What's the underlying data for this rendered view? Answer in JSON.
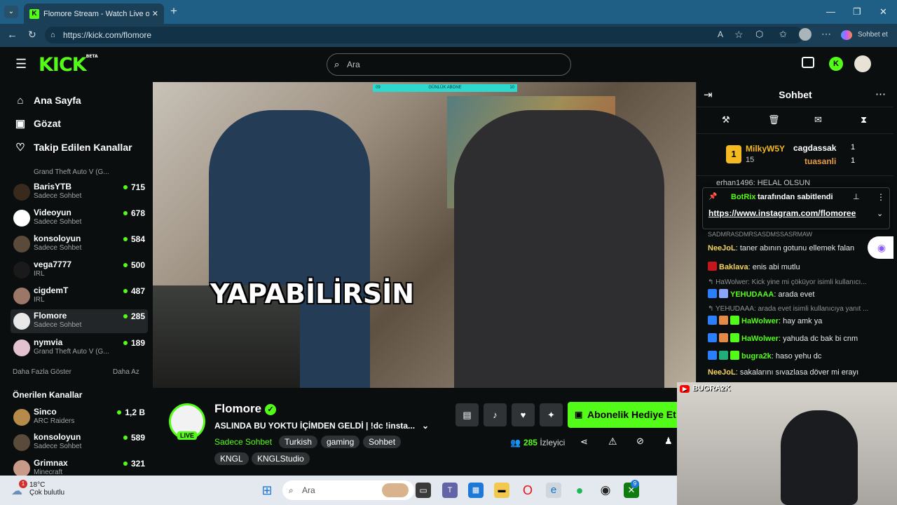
{
  "browser": {
    "tab_title": "Flomore Stream - Watch Live on Kick",
    "url": "https://kick.com/flomore",
    "copilot_label": "Sohbet et",
    "window_controls": [
      "—",
      "❐",
      "✕"
    ]
  },
  "header": {
    "logo_text": "KICK",
    "logo_beta": "BETA",
    "search_placeholder": "Ara"
  },
  "sidebar": {
    "nav": [
      {
        "label": "Ana Sayfa",
        "icon": "home-icon"
      },
      {
        "label": "Gözat",
        "icon": "browse-icon"
      },
      {
        "label": "Takip Edilen Kanallar",
        "icon": "heart-icon"
      }
    ],
    "partial_top_category": "Grand Theft Auto V (G...",
    "followed": [
      {
        "name": "BarisYTB",
        "category": "Sadece Sohbet",
        "viewers": "715"
      },
      {
        "name": "Videoyun",
        "category": "Sadece Sohbet",
        "viewers": "678"
      },
      {
        "name": "konsoloyun",
        "category": "Sadece Sohbet",
        "viewers": "584"
      },
      {
        "name": "vega7777",
        "category": "IRL",
        "viewers": "500"
      },
      {
        "name": "cigdemT",
        "category": "IRL",
        "viewers": "487"
      },
      {
        "name": "Flomore",
        "category": "Sadece Sohbet",
        "viewers": "285"
      },
      {
        "name": "nymvia",
        "category": "Grand Theft Auto V (G...",
        "viewers": "189"
      }
    ],
    "show_more": "Daha Fazla Göster",
    "show_less": "Daha Az",
    "recommended_title": "Önerilen Kanallar",
    "recommended": [
      {
        "name": "Sinco",
        "category": "ARC Raiders",
        "viewers": "1,2 B"
      },
      {
        "name": "konsoloyun",
        "category": "Sadece Sohbet",
        "viewers": "589"
      },
      {
        "name": "Grimnax",
        "category": "Minecraft",
        "viewers": "321"
      }
    ]
  },
  "video": {
    "caption": "YAPABİLİRSİN",
    "sub_goal_label": "GÜNLÜK ABONE",
    "sub_goal_left": "09",
    "sub_goal_right": "10"
  },
  "stream_info": {
    "channel": "Flomore",
    "live_badge": "LIVE",
    "title": "ASLINDA BU YOKTU İÇİMDEN GELDİ | !dc !insta...",
    "category": "Sadece Sohbet",
    "tags": [
      "Turkish",
      "gaming",
      "Sohbet",
      "KNGL",
      "KNGLStudio"
    ],
    "gift_button": "Abonelik Hediye Et",
    "viewer_count": "285",
    "viewer_label": "İzleyici"
  },
  "chat": {
    "title": "Sohbet",
    "leaderboard": {
      "first_name": "MilkyW5Y",
      "first_count": "15",
      "second_name": "cagdassak",
      "second_count": "1",
      "third_name": "tuasanli",
      "third_count": "1"
    },
    "partial_msg": "erhan1496: HELAL OLSUN",
    "pinned": {
      "by_user": "BotRix",
      "by_text": "tarafından sabitlendi",
      "link": "https://www.instagram.com/flomoree",
      "cut_text": "SADMRASDMRSASDMSSASRMAW"
    },
    "messages": [
      {
        "type": "msg",
        "user": "NeeJoL",
        "color": "#f4d35e",
        "text": "taner abının gotunu ellemek falan"
      },
      {
        "type": "msg",
        "user": "Baklava",
        "color": "#f4d35e",
        "text": "enis abi mutlu"
      },
      {
        "type": "reply",
        "text": "↰ HaWolwer: Kick yine mi çöküyor isimli kullanıcı..."
      },
      {
        "type": "msg",
        "user": "YEHUDAAA",
        "color": "#53fc18",
        "text": "arada evet"
      },
      {
        "type": "reply",
        "text": "↰ YEHUDAAA: arada evet isimli kullanıcıya yanıt ..."
      },
      {
        "type": "msg",
        "user": "HaWolwer",
        "color": "#53fc18",
        "text": "hay amk ya"
      },
      {
        "type": "msg",
        "user": "HaWolwer",
        "color": "#53fc18",
        "text": "yahuda dc bak bi cnm"
      },
      {
        "type": "msg",
        "user": "bugra2k",
        "color": "#53fc18",
        "text": "haso yehu dc"
      },
      {
        "type": "msg",
        "user": "NeeJoL",
        "color": "#f4d35e",
        "text": "sakalarını sıvazlasa döver mi erayı"
      }
    ]
  },
  "overlay": {
    "webcam_label": "BUGRA2K"
  },
  "taskbar": {
    "temp": "18°C",
    "weather": "Çok bulutlu",
    "weather_badge": "1",
    "search": "Ara",
    "xbox_badge": "9"
  }
}
